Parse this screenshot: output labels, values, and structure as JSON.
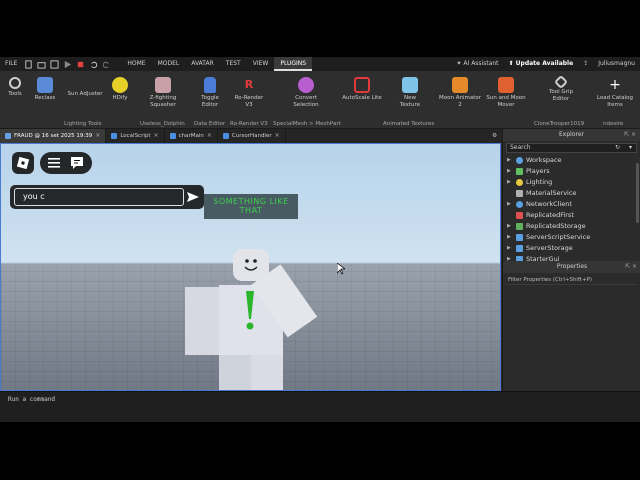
{
  "menubar": {
    "file": "FILE",
    "tabs": [
      "HOME",
      "MODEL",
      "AVATAR",
      "TEST",
      "VIEW",
      "PLUGINS"
    ],
    "assistant": "AI Assistant",
    "update": "Update Available",
    "user": "Juliusmagnu"
  },
  "ribbon": {
    "tools": [
      {
        "label": "Tools",
        "color": "#cfcfcf"
      },
      {
        "label": "Reclass",
        "color": "#5a8ad8"
      },
      {
        "label": "Sun Adjuster",
        "color": "#2e2e2e"
      },
      {
        "label": "HDify",
        "color": "#e6d028"
      },
      {
        "label": "Z-fighting Squasher",
        "color": "#c8a0a8"
      },
      {
        "label": "Toggle Editor",
        "color": "#4a7cd8"
      },
      {
        "label": "Ro-Render V3",
        "color": "#e23b3b"
      },
      {
        "label": "Convert Selection",
        "color": "#b85fd0"
      },
      {
        "label": "AutoScale Lite",
        "color": "#e03a3a"
      },
      {
        "label": "New Texture",
        "color": "#7fc4e8"
      },
      {
        "label": "Moon Animator 2",
        "color": "#e58a2a"
      },
      {
        "label": "Sun and Moon Mover",
        "color": "#e06030"
      },
      {
        "label": "Tool Grip Editor",
        "color": "#cfcfcf"
      },
      {
        "label": "Load Catalog Items",
        "color": "#ffffff"
      }
    ],
    "groups": [
      "Lighting Tools",
      "Useless_Dolphin",
      "Data Editor",
      "Ro-Render V3",
      "SpecialMesh > MeshPart",
      "Animated Textures",
      "CloneTrooper1019",
      "ndesire"
    ]
  },
  "tabs": [
    {
      "label": "FRAUD @ 16 set 2025 19:39",
      "color": "#6a9fe0"
    },
    {
      "label": "LocalScript",
      "color": "#4a90e2"
    },
    {
      "label": "charMain",
      "color": "#4a90e2"
    },
    {
      "label": "CursorHandler",
      "color": "#4a90e2"
    }
  ],
  "viewport": {
    "chat_value": "you c",
    "sign_text": "SOMETHING LIKE THAT"
  },
  "command_placeholder": "Run a command",
  "explorer": {
    "title": "Explorer",
    "search_placeholder": "Search",
    "items": [
      {
        "label": "Workspace",
        "color": "#5aa0e0"
      },
      {
        "label": "Players",
        "color": "#60c060"
      },
      {
        "label": "Lighting",
        "color": "#e8c840"
      },
      {
        "label": "MaterialService",
        "color": "#b0b0b0"
      },
      {
        "label": "NetworkClient",
        "color": "#5aa0e0"
      },
      {
        "label": "ReplicatedFirst",
        "color": "#e05050"
      },
      {
        "label": "ReplicatedStorage",
        "color": "#60b060"
      },
      {
        "label": "ServerScriptService",
        "color": "#5aa0e0"
      },
      {
        "label": "ServerStorage",
        "color": "#5aa0e0"
      },
      {
        "label": "StarterGui",
        "color": "#5aa0e0"
      }
    ]
  },
  "properties": {
    "title": "Properties",
    "filter_placeholder": "Filter Properties (Ctrl+Shift+P)"
  }
}
